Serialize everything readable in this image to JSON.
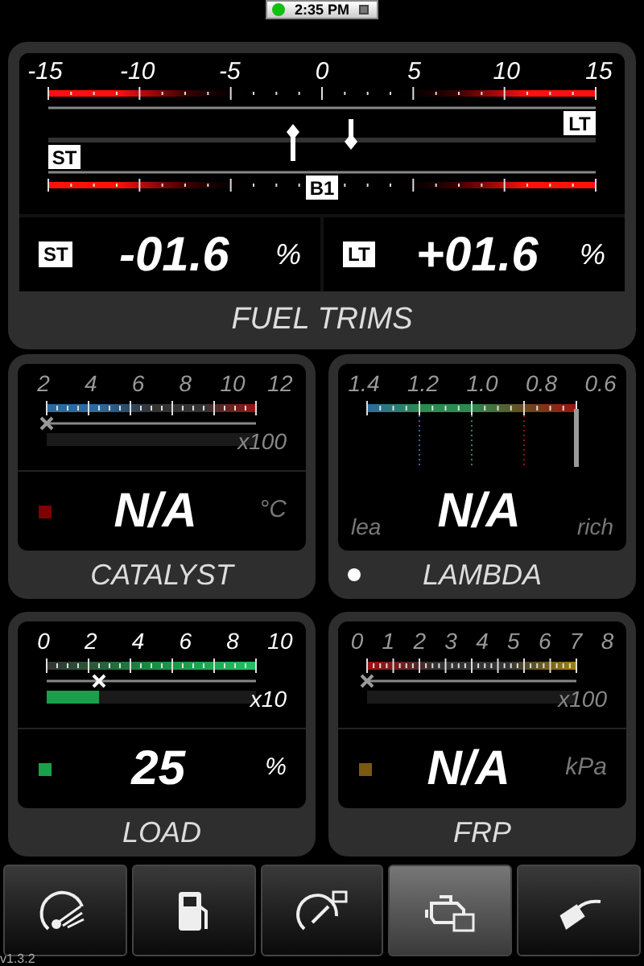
{
  "status_bar": {
    "time": "2:35 PM",
    "connected": true
  },
  "fuel_trims": {
    "title": "FUEL TRIMS",
    "scale": [
      "-15",
      "-10",
      "-5",
      "0",
      "5",
      "10",
      "15"
    ],
    "bank": "B1",
    "st": {
      "marker_tag": "ST",
      "tag": "ST",
      "value": "-01.6",
      "unit": "%",
      "level": 0.447
    },
    "lt": {
      "marker_tag": "LT",
      "tag": "LT",
      "value": "+01.6",
      "unit": "%",
      "level": 0.553
    }
  },
  "gauges": [
    {
      "kind": "temperature",
      "title": "CATALYST",
      "scale": [
        "2",
        "4",
        "6",
        "8",
        "10",
        "12"
      ],
      "multiplier": "x100",
      "value": "N/A",
      "unit": "°C",
      "color": "#800000"
    },
    {
      "kind": "lambda",
      "title": "LAMBDA",
      "scale": [
        "1.4",
        "1.2",
        "1.0",
        "0.8",
        "0.6"
      ],
      "value": "N/A",
      "lean": "lea",
      "rich": "rich",
      "color": "#ffffff"
    },
    {
      "kind": "load",
      "title": "LOAD",
      "scale": [
        "0",
        "2",
        "4",
        "6",
        "8",
        "10"
      ],
      "multiplier": "x10",
      "value": "25",
      "unit": "%",
      "color": "#1aa04a",
      "level": 0.25
    },
    {
      "kind": "pressure",
      "title": "FRP",
      "scale": [
        "0",
        "1",
        "2",
        "3",
        "4",
        "5",
        "6",
        "7",
        "8"
      ],
      "multiplier": "x100",
      "value": "N/A",
      "unit": "kPa",
      "color": "#7a5a10"
    }
  ],
  "tabs": [
    {
      "selected": false
    },
    {
      "selected": false
    },
    {
      "selected": false
    },
    {
      "selected": true
    },
    {
      "selected": false
    }
  ],
  "version": "v1.3.2"
}
